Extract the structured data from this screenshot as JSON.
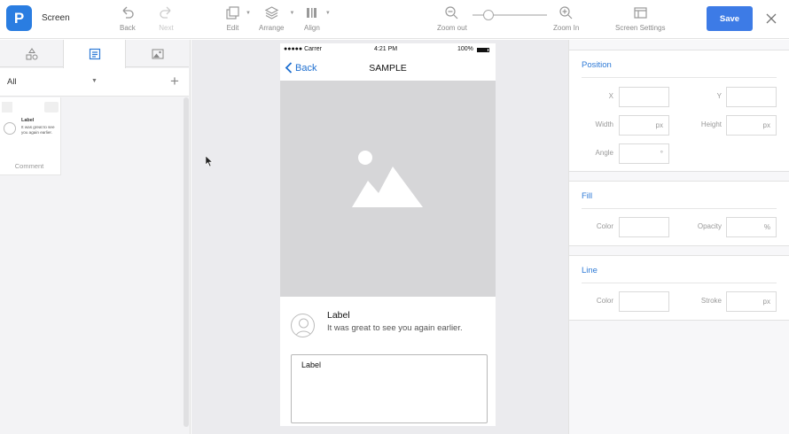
{
  "toolbar": {
    "screen_title": "Screen",
    "back_label": "Back",
    "next_label": "Next",
    "edit_label": "Edit",
    "arrange_label": "Arrange",
    "align_label": "Align",
    "zoom_out_label": "Zoom out",
    "zoom_in_label": "Zoom In",
    "screen_settings_label": "Screen Settings",
    "save_label": "Save",
    "logo_letter": "P",
    "zoom_level": 0.22,
    "accent_color": "#3d7be6"
  },
  "left_panel": {
    "tabs": [
      "shapes-icon",
      "components-icon",
      "image-icon"
    ],
    "active_tab": 1,
    "filter_value": "All",
    "add_symbol": "+",
    "component": {
      "label": "Label",
      "text": "It was great to see you again earlier.",
      "name": "Comment"
    }
  },
  "phone": {
    "carrier": "●●●●● Carrer",
    "time": "4:21 PM",
    "battery": "100%",
    "back_label": "Back",
    "title": "SAMPLE",
    "comment_label": "Label",
    "comment_text": "It was great to see you again earlier.",
    "textbox_label": "Label"
  },
  "right_panel": {
    "position": {
      "title": "Position",
      "x_label": "X",
      "y_label": "Y",
      "width_label": "Width",
      "height_label": "Height",
      "angle_label": "Angle",
      "px_unit": "px",
      "degree_unit": "°"
    },
    "fill": {
      "title": "Fill",
      "color_label": "Color",
      "opacity_label": "Opacity",
      "percent_unit": "%"
    },
    "line": {
      "title": "Line",
      "color_label": "Color",
      "stroke_label": "Stroke",
      "px_unit": "px"
    }
  }
}
